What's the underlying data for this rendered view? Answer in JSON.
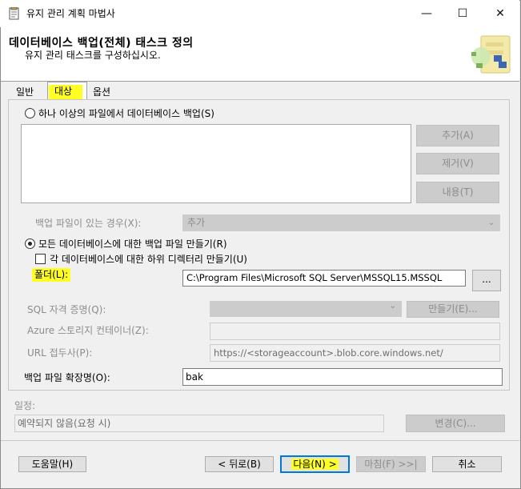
{
  "window": {
    "title": "유지 관리 계획 마법사",
    "minimize_glyph": "—",
    "maximize_glyph": "☐",
    "close_glyph": "✕"
  },
  "header": {
    "title": "데이터베이스 백업(전체) 태스크 정의",
    "subtitle": "유지 관리 태스크를 구성하십시오."
  },
  "tabs": [
    {
      "label": "일반",
      "active": false
    },
    {
      "label": "대상",
      "active": true,
      "highlighted": true
    },
    {
      "label": "옵션",
      "active": false
    }
  ],
  "target": {
    "backup_files_radio": "하나 이상의 파일에서 데이터베이스 백업(S)",
    "buttons": {
      "add": "추가(A)",
      "remove": "제거(V)",
      "contents": "내용(T)"
    },
    "if_backup_exists_label": "백업 파일이 있는 경우(X):",
    "if_backup_exists_value": "추가",
    "per_db_radio": "모든 데이터베이스에 대한 백업 파일 만들기(R)",
    "subdir_checkbox": "각 데이터베이스에 대한 하위 디렉터리 만들기(U)",
    "folder_label": "폴더(L):",
    "folder_value": "C:\\Program Files\\Microsoft SQL Server\\MSSQL15.MSSQL",
    "browse_button": "...",
    "sql_credential_label": "SQL 자격 증명(Q):",
    "create_button": "만들기(E)...",
    "azure_container_label": "Azure 스토리지 컨테이너(Z):",
    "url_prefix_label": "URL 접두사(P):",
    "url_prefix_value": "https://<storageaccount>.blob.core.windows.net/",
    "extension_label": "백업 파일 확장명(O):",
    "extension_value": "bak"
  },
  "schedule": {
    "label": "일정:",
    "value": "예약되지 않음(요청 시)",
    "change_button": "변경(C)..."
  },
  "footer": {
    "help": "도움말(H)",
    "back": "< 뒤로(B)",
    "next": "다음(N) >",
    "finish": "마침(F) >>|",
    "cancel": "취소"
  },
  "colors": {
    "highlight": "#ffff26",
    "default_button_border": "#0078d7",
    "disabled_text": "#8c8c8c"
  }
}
